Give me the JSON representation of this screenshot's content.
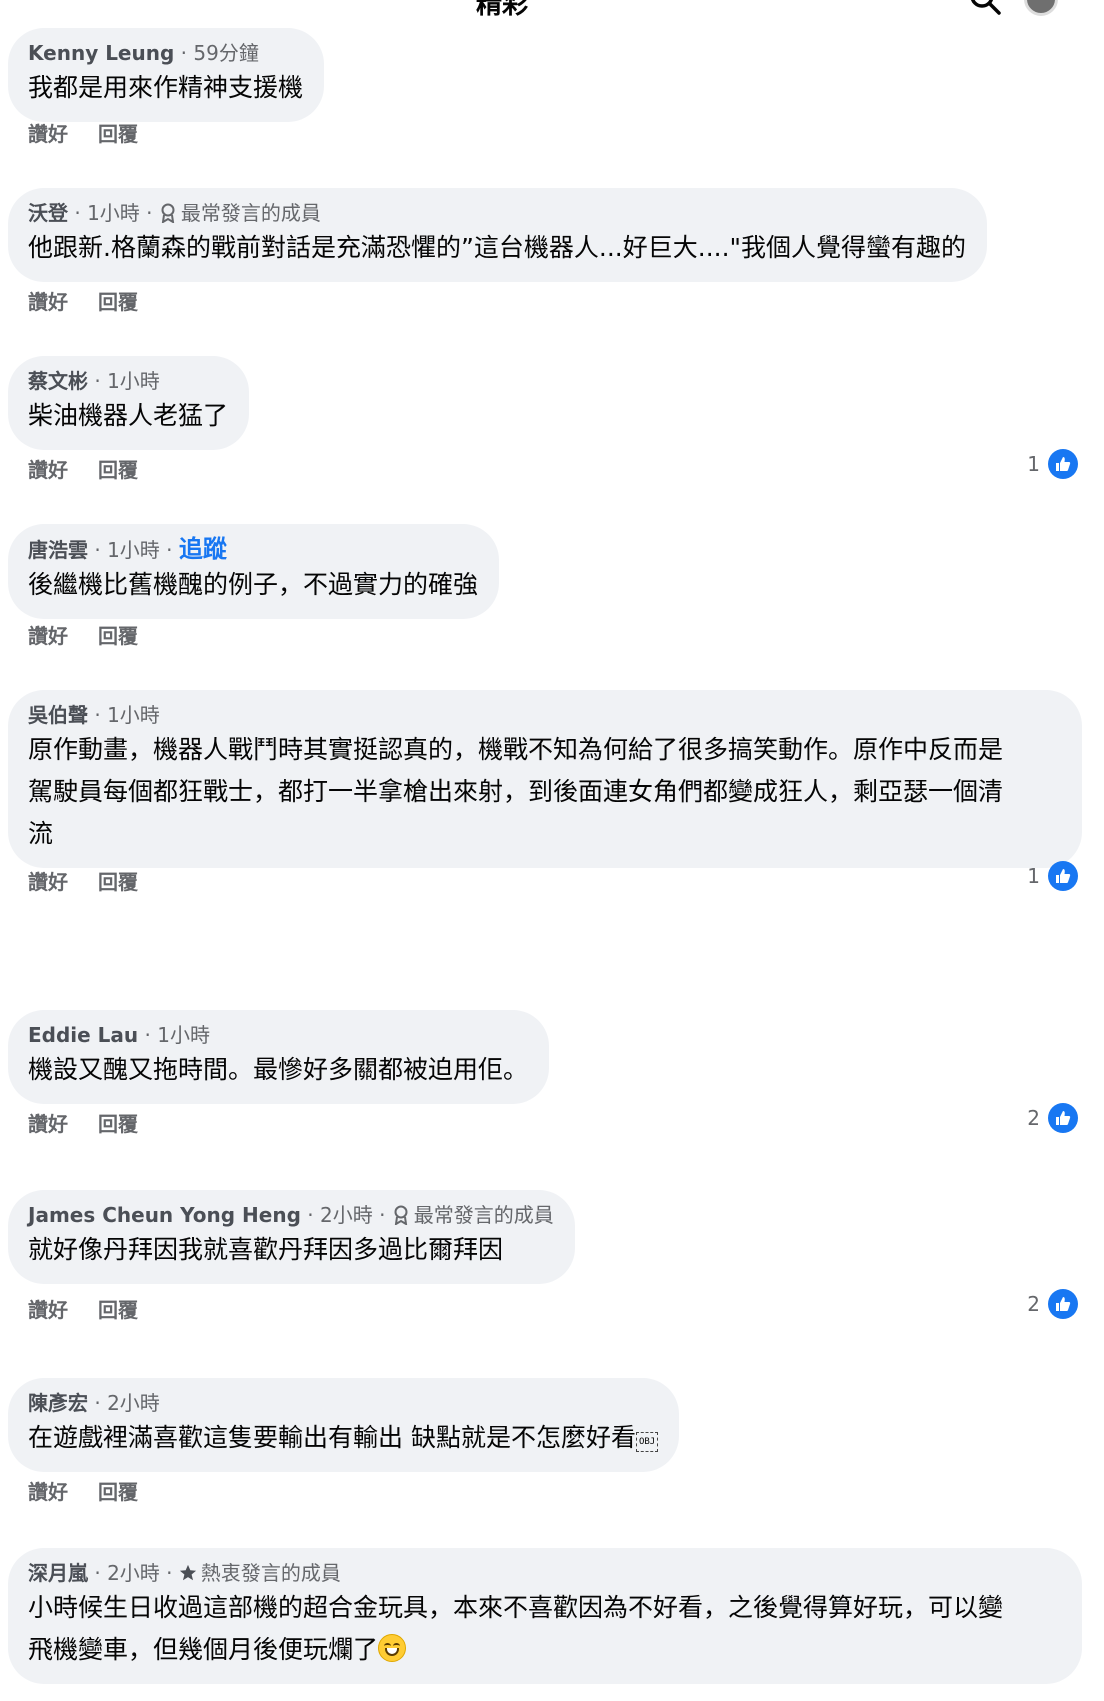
{
  "header": {
    "title": "精彩"
  },
  "actions": {
    "like": "讚好",
    "reply": "回覆"
  },
  "comments": [
    {
      "author": "Kenny Leung",
      "time": "59分鐘",
      "badge": "",
      "text": "我都是用來作精神支援機",
      "likes": ""
    },
    {
      "author": "沃登",
      "time": "1小時",
      "badge": "最常發言的成員",
      "text": "他跟新.格蘭森的戰前對話是充滿恐懼的”這台機器人...好巨大....\"我個人覺得蠻有趣的",
      "likes": ""
    },
    {
      "author": "蔡文彬",
      "time": "1小時",
      "badge": "",
      "text": "柴油機器人老猛了",
      "likes": "1"
    },
    {
      "author": "唐浩雲",
      "time": "1小時",
      "follow": "追蹤",
      "text": "後繼機比舊機醜的例子，不過實力的確強",
      "likes": ""
    },
    {
      "author": "吳伯聲",
      "time": "1小時",
      "badge": "",
      "text": "原作動畫，機器人戰鬥時其實挺認真的，機戰不知為何給了很多搞笑動作。原作中反而是\n駕駛員每個都狂戰士，都打一半拿槍出來射，到後面連女角們都變成狂人，剩亞瑟一個清\n流",
      "likes": "1"
    },
    {
      "author": "Eddie Lau",
      "time": "1小時",
      "badge": "",
      "text": "機設又醜又拖時間。最慘好多關都被迫用佢。",
      "likes": "2"
    },
    {
      "author": "James Cheun Yong Heng",
      "time": "2小時",
      "badge": "最常發言的成員",
      "text": "就好像丹拜因我就喜歡丹拜因多過比爾拜因",
      "likes": "2"
    },
    {
      "author": "陳彥宏",
      "time": "2小時",
      "badge": "",
      "text": "在遊戲裡滿喜歡這隻要輸出有輸出 缺點就是不怎麼好看",
      "obj": "OBJ",
      "likes": ""
    },
    {
      "author": "深月嵐",
      "time": "2小時",
      "badge": "熱衷發言的成員",
      "text": "小時候生日收過這部機的超合金玩具，本來不喜歡因為不好看，之後覺得算好玩，可以變\n飛機變車，但幾個月後便玩爛了",
      "likes": ""
    }
  ],
  "colors": {
    "accent": "#1877f2",
    "bubble": "#f0f2f5",
    "meta": "#65676b"
  }
}
